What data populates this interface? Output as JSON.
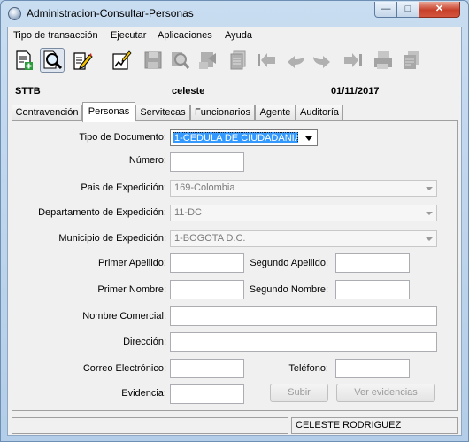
{
  "window": {
    "title": "Administracion-Consultar-Personas",
    "min_glyph": "—",
    "max_glyph": "□",
    "close_glyph": "✕"
  },
  "menu": {
    "items": [
      "Tipo de transacción",
      "Ejecutar",
      "Aplicaciones",
      "Ayuda"
    ]
  },
  "toolbar": {
    "buttons": [
      {
        "icon": "new-document-icon",
        "enabled": true
      },
      {
        "icon": "search-query-icon",
        "enabled": true,
        "pressed": true
      },
      {
        "icon": "edit-document-icon",
        "enabled": true
      },
      {
        "icon": "chart-edit-icon",
        "enabled": true
      },
      {
        "icon": "save-icon",
        "enabled": false
      },
      {
        "icon": "zoom-icon",
        "enabled": false
      },
      {
        "icon": "process-icon",
        "enabled": false
      },
      {
        "icon": "document-list-icon",
        "enabled": false
      },
      {
        "icon": "first-record-icon",
        "enabled": false
      },
      {
        "icon": "previous-record-icon",
        "enabled": false
      },
      {
        "icon": "next-record-icon",
        "enabled": false
      },
      {
        "icon": "last-record-icon",
        "enabled": false
      },
      {
        "icon": "print-icon",
        "enabled": false
      },
      {
        "icon": "report-icon",
        "enabled": false
      }
    ]
  },
  "info": {
    "code": "STTB",
    "user": "celeste",
    "date": "01/11/2017"
  },
  "tabs": [
    {
      "label": "Contravención",
      "active": false
    },
    {
      "label": "Personas",
      "active": true
    },
    {
      "label": "Servitecas",
      "active": false
    },
    {
      "label": "Funcionarios",
      "active": false
    },
    {
      "label": "Agente",
      "active": false
    },
    {
      "label": "Auditoría",
      "active": false
    }
  ],
  "form": {
    "tipo_documento": {
      "label": "Tipo de Documento:",
      "value": "1-CEDULA DE CIUDADANIA"
    },
    "numero": {
      "label": "Número:",
      "value": ""
    },
    "pais": {
      "label": "Pais de Expedición:",
      "value": "169-Colombia"
    },
    "departamento": {
      "label": "Departamento de Expedición:",
      "value": "11-DC"
    },
    "municipio": {
      "label": "Municipio de Expedición:",
      "value": "1-BOGOTA D.C."
    },
    "primer_apellido": {
      "label": "Primer Apellido:",
      "value": ""
    },
    "segundo_apellido": {
      "label": "Segundo Apellido:",
      "value": ""
    },
    "primer_nombre": {
      "label": "Primer Nombre:",
      "value": ""
    },
    "segundo_nombre": {
      "label": "Segundo Nombre:",
      "value": ""
    },
    "nombre_comercial": {
      "label": "Nombre Comercial:",
      "value": ""
    },
    "direccion": {
      "label": "Dirección:",
      "value": ""
    },
    "correo": {
      "label": "Correo Electrónico:",
      "value": ""
    },
    "telefono": {
      "label": "Teléfono:",
      "value": ""
    },
    "evidencia": {
      "label": "Evidencia:",
      "value": ""
    },
    "subir_label": "Subir",
    "ver_evidencias_label": "Ver evidencias"
  },
  "status": {
    "left": "",
    "user_name": "CELESTE  RODRIGUEZ"
  }
}
